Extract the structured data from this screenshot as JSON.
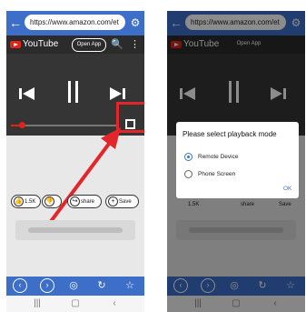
{
  "browser": {
    "url": "https://www.amazon.com/et",
    "back_icon": "arrow-left-icon",
    "settings_icon": "gear-icon"
  },
  "youtube": {
    "logo_text": "YouTube",
    "open_app_label": "Open App"
  },
  "player": {
    "progress_fraction": 0.08
  },
  "actions": {
    "like_count": "1.5K",
    "share_label": "share",
    "save_label": "Save"
  },
  "dialog": {
    "title": "Please select playback mode",
    "options": [
      {
        "label": "Remote Device",
        "selected": true
      },
      {
        "label": "Phone Screen",
        "selected": false
      }
    ],
    "ok_label": "OK"
  },
  "right_partial": {
    "like_count": "1.5K",
    "share_label": "share",
    "save_label": "Save"
  },
  "colors": {
    "accent": "#3d6ec8",
    "youtube_red": "#e62117",
    "highlight": "#e3262a"
  }
}
